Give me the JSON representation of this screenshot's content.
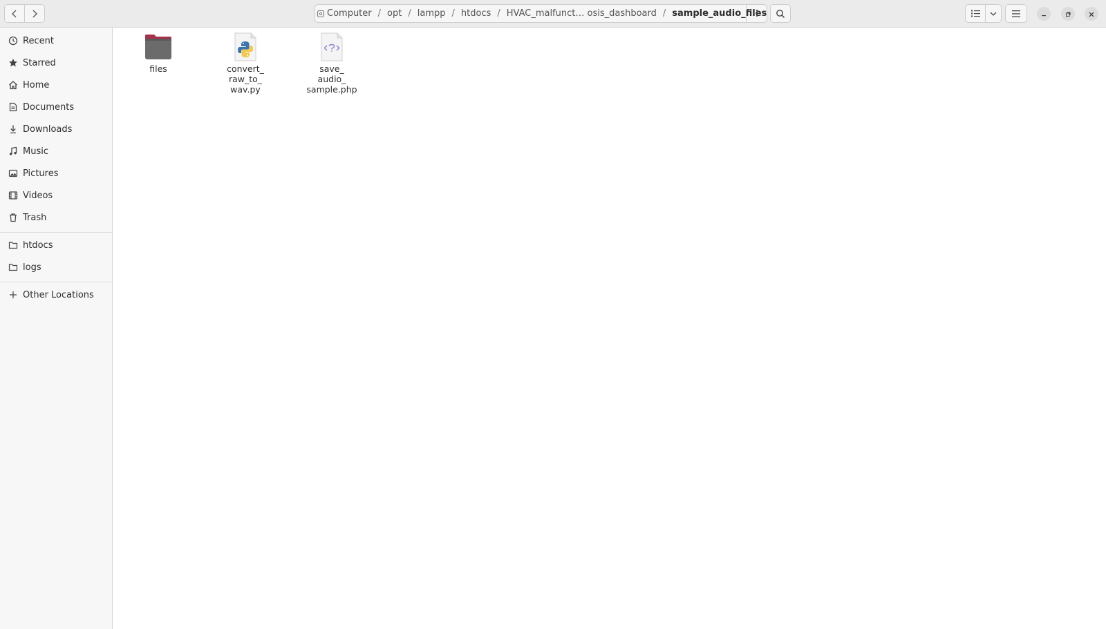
{
  "headerbar": {
    "path": {
      "segments": [
        "Computer",
        "opt",
        "lampp",
        "htdocs",
        "HVAC_malfunct… osis_dashboard"
      ],
      "current": "sample_audio_files",
      "separator": "/"
    }
  },
  "sidebar": {
    "places": [
      {
        "label": "Recent",
        "icon": "clock-icon"
      },
      {
        "label": "Starred",
        "icon": "star-icon"
      },
      {
        "label": "Home",
        "icon": "home-icon"
      },
      {
        "label": "Documents",
        "icon": "document-icon"
      },
      {
        "label": "Downloads",
        "icon": "download-icon"
      },
      {
        "label": "Music",
        "icon": "music-icon"
      },
      {
        "label": "Pictures",
        "icon": "picture-icon"
      },
      {
        "label": "Videos",
        "icon": "video-icon"
      },
      {
        "label": "Trash",
        "icon": "trash-icon"
      }
    ],
    "bookmarks": [
      {
        "label": "htdocs",
        "icon": "folder-icon"
      },
      {
        "label": "logs",
        "icon": "folder-icon"
      }
    ],
    "other_locations": {
      "label": "Other Locations",
      "icon": "plus-icon"
    }
  },
  "content": {
    "files": [
      {
        "name": "files",
        "type": "folder",
        "icon": "folder-icon"
      },
      {
        "name": "convert_\nraw_to_\nwav.py",
        "type": "python",
        "icon": "python-file-icon"
      },
      {
        "name": "save_\naudio_\nsample.php",
        "type": "php",
        "icon": "php-file-icon"
      }
    ]
  },
  "colors": {
    "folder_body": "#6b6b6b",
    "folder_tab": "#a8324a",
    "python_blue": "#3a75b0",
    "python_yellow": "#f2c94c",
    "php_purple": "#8b7fd1"
  }
}
